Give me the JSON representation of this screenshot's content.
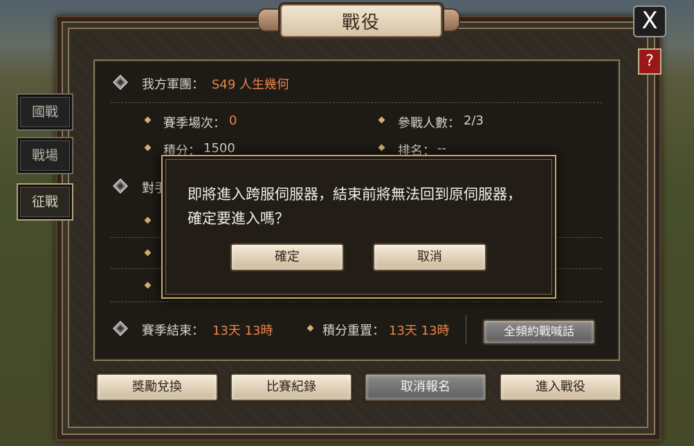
{
  "title": "戰役",
  "close_label": "X",
  "help_label": "?",
  "side_tabs": [
    {
      "label": "國戰",
      "active": false
    },
    {
      "label": "戰場",
      "active": false
    },
    {
      "label": "征戰",
      "active": true
    }
  ],
  "my_legion": {
    "label": "我方軍團：",
    "value": "S49 人生幾何"
  },
  "stats": {
    "season_matches_label": "賽季場次：",
    "season_matches_value": "0",
    "participants_label": "參戰人數：",
    "participants_value": "2/3",
    "points_label": "積分：",
    "points_value": "1500",
    "rank_label": "排名：",
    "rank_value": "--"
  },
  "opponent_label_partial": "對手",
  "season_end": {
    "label": "賽季結束：",
    "value": "13天 13時"
  },
  "points_reset": {
    "label": "積分重置：",
    "value": "13天 13時"
  },
  "shout_button": "全頻約戰喊話",
  "bottom_buttons": [
    "獎勵兌換",
    "比賽紀錄",
    "取消報名",
    "進入戰役"
  ],
  "dialog": {
    "message": "即將進入跨服伺服器，結束前將無法回到原伺服器，確定要進入嗎？",
    "confirm": "確定",
    "cancel": "取消"
  },
  "colors": {
    "accent_orange": "#e8864a",
    "frame_gold": "#c9a968",
    "help_red": "#9a1818"
  }
}
